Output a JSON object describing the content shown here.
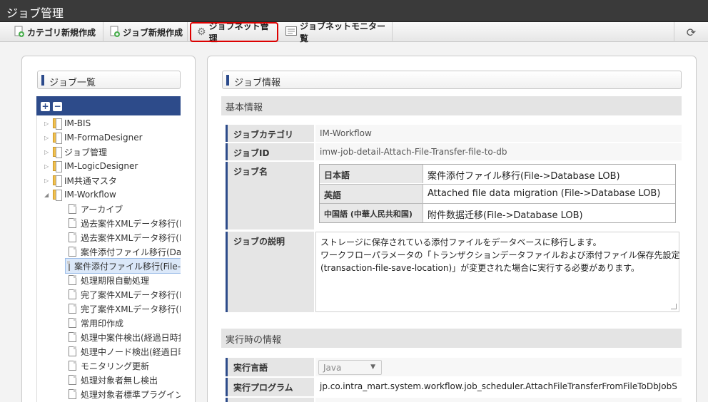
{
  "window": {
    "title": "ジョブ管理"
  },
  "toolbar": {
    "items": [
      {
        "label": "カテゴリ新規作成"
      },
      {
        "label": "ジョブ新規作成"
      },
      {
        "label": "ジョブネット管理"
      },
      {
        "label": "ジョブネットモニター覧"
      }
    ]
  },
  "left": {
    "heading": "ジョブ一覧",
    "folders": [
      "IM-BIS",
      "IM-FormaDesigner",
      "ジョブ管理",
      "IM-LogicDesigner",
      "IM共通マスタ",
      "IM-Workflow"
    ],
    "jobs": [
      "アーカイブ",
      "過去案件XMLデータ移行(DB->File)",
      "過去案件XMLデータ移行(File->DB)",
      "案件添付ファイル移行(Database LOB->File)",
      "案件添付ファイル移行(File->Database LOB)",
      "処理期限自動処理",
      "完了案件XMLデータ移行(DB->File)",
      "完了案件XMLデータ移行(File->DB)",
      "常用印作成",
      "処理中案件検出(経過日時指定)",
      "処理中ノード検出(経過日時指定)",
      "モニタリング更新",
      "処理対象者無し検出",
      "処理対象者標準プラグイン組み合わせ"
    ]
  },
  "right": {
    "heading": "ジョブ情報",
    "basic_section": "基本情報",
    "labels": {
      "category": "ジョブカテゴリ",
      "id": "ジョブID",
      "name": "ジョブ名",
      "description": "ジョブの説明",
      "run_lang": "実行言語",
      "run_program": "実行プログラム"
    },
    "values": {
      "category": "IM-Workflow",
      "id": "imw-job-detail-Attach-File-Transfer-file-to-db"
    },
    "names": [
      {
        "lang": "日本語",
        "value": "案件添付ファイル移行(File->Database LOB)"
      },
      {
        "lang": "英語",
        "value": "Attached file data migration (File->Database LOB)"
      },
      {
        "lang": "中国語 (中華人民共和国)",
        "value": "附件数据迁移(File->Database LOB)"
      }
    ],
    "description_lines": [
      "ストレージに保存されている添付ファイルをデータベースに移行します。",
      "ワークフローパラメータの「トランザクションデータファイルおよび添付ファイル保存先設定",
      "(transaction-file-save-location)」が変更された場合に実行する必要があります。"
    ],
    "runtime_section": "実行時の情報",
    "run_lang_value": "Java",
    "run_program_value": "jp.co.intra_mart.system.workflow.job_scheduler.AttachFileTransferFromFileToDbJobS"
  }
}
